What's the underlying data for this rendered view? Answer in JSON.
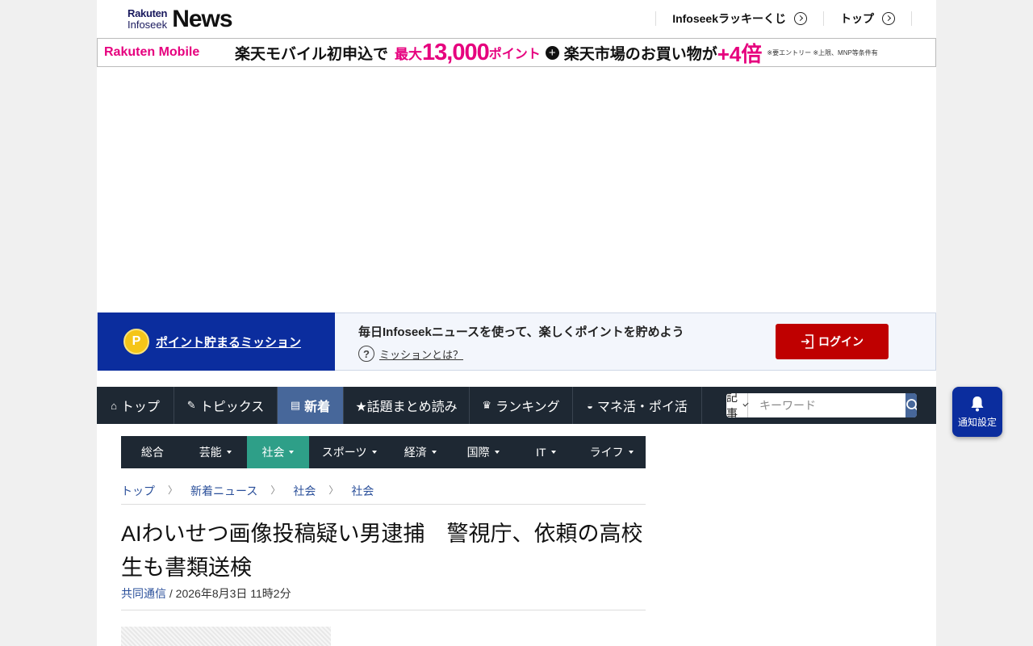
{
  "header": {
    "logo_small_1": "Rakuten",
    "logo_small_2": "Infoseek",
    "logo_big": "News",
    "links": [
      {
        "label": "Infoseekラッキーくじ"
      },
      {
        "label": "トップ"
      }
    ]
  },
  "banner": {
    "brand": "Rakuten Mobile",
    "text1": "楽天モバイル初申込で",
    "text2": "最大",
    "big": "13,000",
    "text3": "ポイント",
    "plus": "+",
    "text4": "楽天市場のお買い物が",
    "boost": "+4倍",
    "note": "※要エントリー ※上限、MNP等条件有"
  },
  "mission": {
    "coin": "P",
    "title": "ポイント貯まるミッション",
    "description": "毎日Infoseekニュースを使って、楽しくポイントを貯めよう",
    "help_icon": "?",
    "help_label": "ミッションとは？",
    "login_label": "ログイン"
  },
  "main_nav": {
    "items": [
      {
        "label": "トップ",
        "icon": "home-icon",
        "glyph": "⌂"
      },
      {
        "label": "トピックス",
        "icon": "pencil-icon",
        "glyph": "✎"
      },
      {
        "label": "新着",
        "icon": "document-icon",
        "glyph": "▤"
      },
      {
        "label": "★話題まとめ読み",
        "icon": "",
        "glyph": ""
      },
      {
        "label": "ランキング",
        "icon": "crown-icon",
        "glyph": "♛"
      },
      {
        "label": "マネ活・ポイ活",
        "icon": "wallet-icon",
        "glyph": "◒"
      }
    ],
    "active_index": 2
  },
  "search": {
    "type": "記事",
    "placeholder": "キーワード"
  },
  "sub_nav": {
    "items": [
      "総合",
      "芸能",
      "社会",
      "スポーツ",
      "経済",
      "国際",
      "IT",
      "ライフ"
    ],
    "active_index": 2
  },
  "breadcrumb": [
    "トップ",
    "新着ニュース",
    "社会",
    "社会"
  ],
  "article": {
    "title": "AIわいせつ画像投稿疑い男逮捕　警視庁、依頼の高校生も書類送検",
    "source": "共同通信",
    "date": " / 2026年8月3日 11時2分"
  },
  "notify": {
    "label": "通知設定"
  },
  "colors": {
    "nav_bg": "#1e2833",
    "nav_active": "#47679a",
    "sub_active": "#2e9f88",
    "mission_blue": "#0b2d9e",
    "login_red": "#bf0000",
    "link_blue": "#2a4f9a",
    "brand_pink": "#e6007e"
  }
}
